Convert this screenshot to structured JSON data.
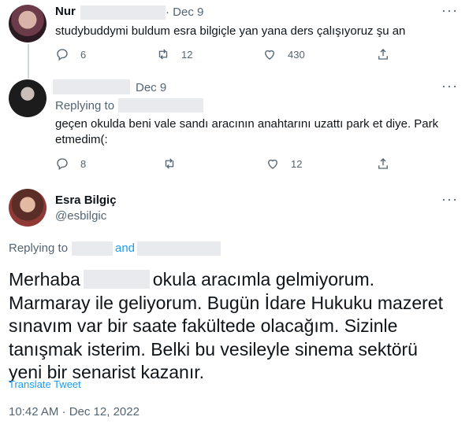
{
  "tweets": [
    {
      "name": "Nur",
      "date": "· Dec 9",
      "text": "studybuddymi buldum esra bilgiçle yan yana ders çalışıyoruz şu an",
      "replies": "6",
      "retweets": "12",
      "likes": "430"
    },
    {
      "date": "Dec 9",
      "replying_label": "Replying to",
      "text": "geçen okulda beni vale sandı aracının anahtarını uzattı park et diye. Park etmedim(:",
      "replies": "8",
      "retweets": "",
      "likes": "12"
    }
  ],
  "main": {
    "name": "Esra Bilgiç",
    "handle": "@esbilgic",
    "replying_label": "Replying to",
    "and_label": "and",
    "text_start": "Merhaba",
    "text_rest": "okula aracımla gelmiyorum. Marmaray ile geliyorum. Bugün İdare Hukuku mazeret sınavım var bir saate fakültede olacağım. Sizinle tanışmak isterim. Belki bu vesileyle sinema sektörü yeni bir senarist kazanır.",
    "translate": "Translate Tweet",
    "timestamp": "10:42 AM · Dec 12, 2022"
  },
  "icons": [
    "reply-icon",
    "retweet-icon",
    "like-icon",
    "share-icon",
    "more-icon"
  ]
}
